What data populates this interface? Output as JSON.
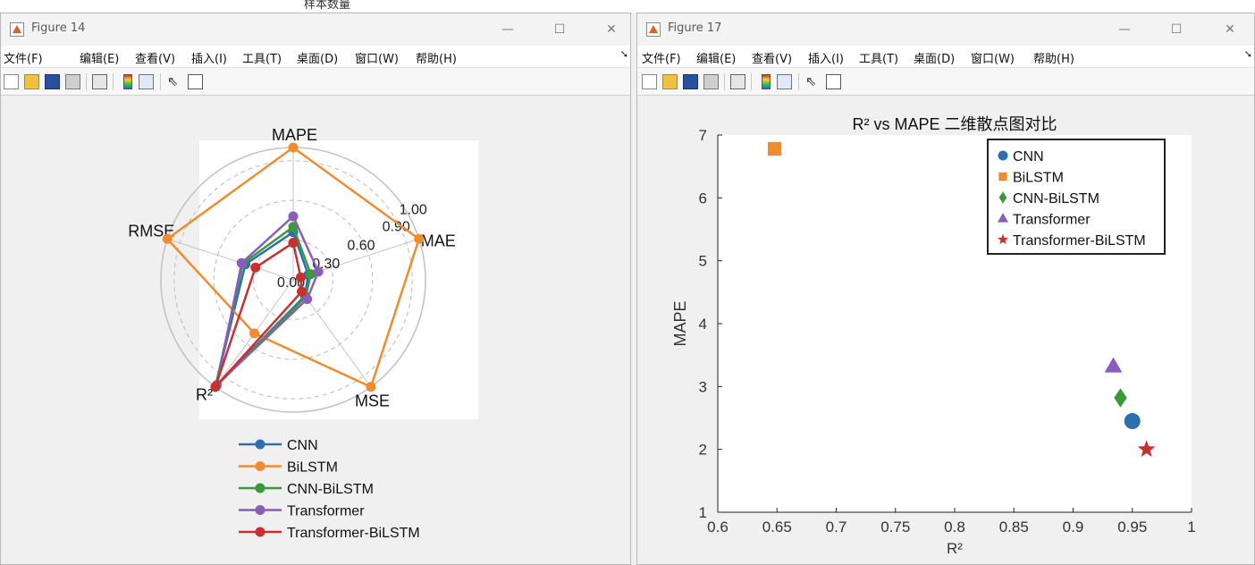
{
  "background_fragment": "样本数量",
  "window_controls": {
    "minimize": "—",
    "maximize": "☐",
    "close": "✕"
  },
  "figure14": {
    "title": "Figure 14",
    "menu": [
      "文件(F)",
      "编辑(E)",
      "查看(V)",
      "插入(I)",
      "工具(T)",
      "桌面(D)",
      "窗口(W)",
      "帮助(H)"
    ],
    "menu_overflow_icon": "chevron-icon",
    "toolbar_icons": [
      "new-figure-icon",
      "open-folder-icon",
      "save-disk-icon",
      "print-icon",
      "print-preview-icon",
      "colorbar-icon",
      "legend-icon",
      "pointer-arrow-icon",
      "property-inspector-icon"
    ],
    "chart_data": {
      "type": "radar",
      "axes": [
        "MAPE",
        "MAE",
        "MSE",
        "R²",
        "RMSE"
      ],
      "radial_ticks": [
        0.0,
        0.3,
        0.6,
        0.9,
        1.0
      ],
      "radial_tick_labels": [
        "0.00",
        "0.30",
        "0.60",
        "0.90",
        "1.00"
      ],
      "rlim": [
        0,
        1
      ],
      "grid": true,
      "legend_position": "bottom",
      "series": [
        {
          "name": "CNN",
          "color": "#2e6fb0",
          "values": [
            0.36,
            0.12,
            0.15,
            1.0,
            0.38
          ]
        },
        {
          "name": "BiLSTM",
          "color": "#f08b2e",
          "values": [
            1.0,
            1.0,
            1.0,
            0.5,
            1.0
          ]
        },
        {
          "name": "CNN-BiLSTM",
          "color": "#3a9a3a",
          "values": [
            0.4,
            0.14,
            0.16,
            1.0,
            0.4
          ]
        },
        {
          "name": "Transformer",
          "color": "#8a5cbd",
          "values": [
            0.48,
            0.2,
            0.18,
            0.98,
            0.41
          ]
        },
        {
          "name": "Transformer-BiLSTM",
          "color": "#c82f2f",
          "values": [
            0.28,
            0.06,
            0.11,
            1.0,
            0.3
          ]
        }
      ]
    }
  },
  "figure17": {
    "title": "Figure 17",
    "menu": [
      "文件(F)",
      "编辑(E)",
      "查看(V)",
      "插入(I)",
      "工具(T)",
      "桌面(D)",
      "窗口(W)",
      "帮助(H)"
    ],
    "menu_overflow_icon": "chevron-icon",
    "toolbar_icons": [
      "new-figure-icon",
      "open-folder-icon",
      "save-disk-icon",
      "print-icon",
      "print-preview-icon",
      "colorbar-icon",
      "legend-icon",
      "pointer-arrow-icon",
      "property-inspector-icon"
    ],
    "chart_data": {
      "type": "scatter",
      "title": "R² vs MAPE 二维散点图对比",
      "xlabel": "R²",
      "ylabel": "MAPE",
      "xlim": [
        0.6,
        1.0
      ],
      "ylim": [
        1,
        7
      ],
      "xticks": [
        0.6,
        0.65,
        0.7,
        0.75,
        0.8,
        0.85,
        0.9,
        0.95,
        1.0
      ],
      "xtick_labels": [
        "0.6",
        "0.65",
        "0.7",
        "0.75",
        "0.8",
        "0.85",
        "0.9",
        "0.95",
        "1"
      ],
      "yticks": [
        1,
        2,
        3,
        4,
        5,
        6,
        7
      ],
      "ytick_labels": [
        "1",
        "2",
        "3",
        "4",
        "5",
        "6",
        "7"
      ],
      "grid": false,
      "legend_position": "top-right",
      "series": [
        {
          "name": "CNN",
          "marker": "circle",
          "color": "#2e6fb0",
          "x": 0.95,
          "y": 2.45
        },
        {
          "name": "BiLSTM",
          "marker": "square",
          "color": "#f08b2e",
          "x": 0.648,
          "y": 6.78
        },
        {
          "name": "CNN-BiLSTM",
          "marker": "diamond",
          "color": "#3a9a3a",
          "x": 0.94,
          "y": 2.82
        },
        {
          "name": "Transformer",
          "marker": "triangle",
          "color": "#8a5cbd",
          "x": 0.934,
          "y": 3.32
        },
        {
          "name": "Transformer-BiLSTM",
          "marker": "star",
          "color": "#c82f2f",
          "x": 0.962,
          "y": 2.0
        }
      ]
    }
  }
}
